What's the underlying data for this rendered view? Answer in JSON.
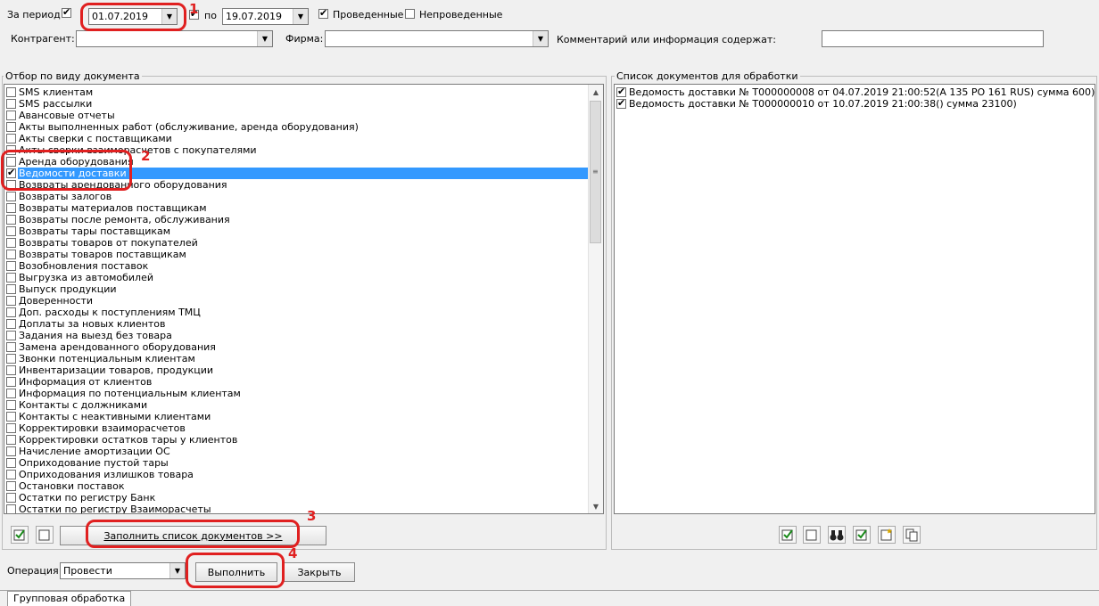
{
  "filter": {
    "period_label": "За период",
    "period_checked": true,
    "date_from": "01.07.2019",
    "to_label": "по",
    "date_to": "19.07.2019",
    "posted_label": "Проведенные",
    "posted_checked": true,
    "unposted_label": "Непроведенные",
    "unposted_checked": false,
    "counterparty_label": "Контрагент:",
    "counterparty_value": "",
    "company_label": "Фирма:",
    "company_value": "",
    "comment_label": "Комментарий или информация содержат:",
    "comment_value": ""
  },
  "left_panel": {
    "title": "Отбор по виду документа",
    "items": [
      {
        "label": "SMS клиентам",
        "checked": false
      },
      {
        "label": "SMS рассылки",
        "checked": false
      },
      {
        "label": "Авансовые отчеты",
        "checked": false
      },
      {
        "label": "Акты выполненных работ (обслуживание, аренда оборудования)",
        "checked": false
      },
      {
        "label": "Акты сверки с поставщиками",
        "checked": false
      },
      {
        "label": "Акты сверки взаиморасчетов с покупателями",
        "checked": false
      },
      {
        "label": "Аренда оборудования",
        "checked": false
      },
      {
        "label": "Ведомости доставки",
        "checked": true
      },
      {
        "label": "Возвраты арендованного оборудования",
        "checked": false
      },
      {
        "label": "Возвраты залогов",
        "checked": false
      },
      {
        "label": "Возвраты материалов поставщикам",
        "checked": false
      },
      {
        "label": "Возвраты после ремонта, обслуживания",
        "checked": false
      },
      {
        "label": "Возвраты тары поставщикам",
        "checked": false
      },
      {
        "label": "Возвраты товаров от покупателей",
        "checked": false
      },
      {
        "label": "Возвраты товаров поставщикам",
        "checked": false
      },
      {
        "label": "Возобновления поставок",
        "checked": false
      },
      {
        "label": "Выгрузка из автомобилей",
        "checked": false
      },
      {
        "label": "Выпуск продукции",
        "checked": false
      },
      {
        "label": "Доверенности",
        "checked": false
      },
      {
        "label": "Доп. расходы к поступлениям ТМЦ",
        "checked": false
      },
      {
        "label": "Доплаты за новых клиентов",
        "checked": false
      },
      {
        "label": "Задания на выезд без товара",
        "checked": false
      },
      {
        "label": "Замена арендованного оборудования",
        "checked": false
      },
      {
        "label": "Звонки потенциальным клиентам",
        "checked": false
      },
      {
        "label": "Инвентаризации товаров, продукции",
        "checked": false
      },
      {
        "label": "Информация от клиентов",
        "checked": false
      },
      {
        "label": "Информация по потенциальным клиентам",
        "checked": false
      },
      {
        "label": "Контакты с должниками",
        "checked": false
      },
      {
        "label": "Контакты с неактивными клиентами",
        "checked": false
      },
      {
        "label": "Корректировки взаиморасчетов",
        "checked": false
      },
      {
        "label": "Корректировки остатков тары у клиентов",
        "checked": false
      },
      {
        "label": "Начисление амортизации ОС",
        "checked": false
      },
      {
        "label": "Оприходование пустой тары",
        "checked": false
      },
      {
        "label": "Оприходования излишков товара",
        "checked": false
      },
      {
        "label": "Остановки поставок",
        "checked": false
      },
      {
        "label": "Остатки по регистру Банк",
        "checked": false
      },
      {
        "label": "Остатки по регистру Взаиморасчеты",
        "checked": false
      }
    ],
    "selected_index": 7,
    "fill_button": "Заполнить список документов >>"
  },
  "right_panel": {
    "title": "Список документов для обработки",
    "items": [
      {
        "label": "Ведомость доставки № Т000000008 от 04.07.2019 21:00:52(А 135 РО 161 RUS) сумма 600)",
        "checked": true
      },
      {
        "label": "Ведомость доставки № Т000000010 от 10.07.2019 21:00:38() сумма 23100)",
        "checked": true
      }
    ]
  },
  "footer": {
    "operation_label": "Операция",
    "operation_value": "Провести",
    "execute_button": "Выполнить",
    "close_button": "Закрыть",
    "tab_label": "Групповая обработка"
  },
  "annotations": {
    "marker1": "1",
    "marker2": "2",
    "marker3": "3",
    "marker4": "4",
    "color": "#e02020"
  },
  "colors": {
    "selection": "#3399ff",
    "background": "#f0f0f0"
  }
}
